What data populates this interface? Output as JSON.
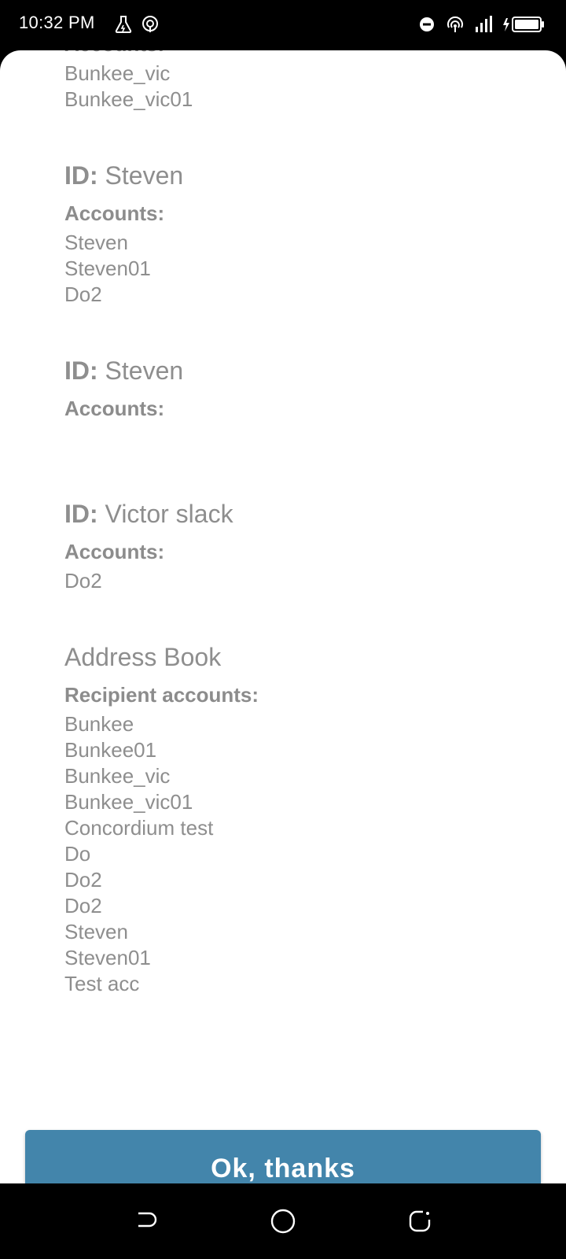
{
  "status_bar": {
    "time": "10:32 PM",
    "left_icons": [
      "flask-icon",
      "hotspot-icon"
    ],
    "right_icons": [
      "do-not-disturb-icon",
      "wifi-hotspot-icon",
      "cell-signal-icon",
      "battery-charging-icon"
    ]
  },
  "content": {
    "top_block": {
      "accounts_label": "Accounts:",
      "accounts": [
        "Bunkee_vic",
        "Bunkee_vic01"
      ]
    },
    "identities": [
      {
        "id_key": "ID:",
        "id_value": "Steven",
        "accounts_label": "Accounts:",
        "accounts": [
          "Steven",
          "Steven01",
          "Do2"
        ]
      },
      {
        "id_key": "ID:",
        "id_value": "Steven",
        "accounts_label": "Accounts:",
        "accounts": []
      },
      {
        "id_key": "ID:",
        "id_value": "Victor slack",
        "accounts_label": "Accounts:",
        "accounts": [
          "Do2"
        ]
      }
    ],
    "address_book": {
      "title": "Address Book",
      "recipients_label": "Recipient accounts:",
      "recipients": [
        "Bunkee",
        "Bunkee01",
        "Bunkee_vic",
        "Bunkee_vic01",
        "Concordium test",
        "Do",
        "Do2",
        "Do2",
        "Steven",
        "Steven01",
        "Test acc"
      ]
    }
  },
  "ok_button": {
    "label": "Ok, thanks",
    "color": "#4385ab"
  },
  "nav_bar": {
    "icons": [
      "back-icon",
      "home-icon",
      "recents-icon"
    ]
  }
}
